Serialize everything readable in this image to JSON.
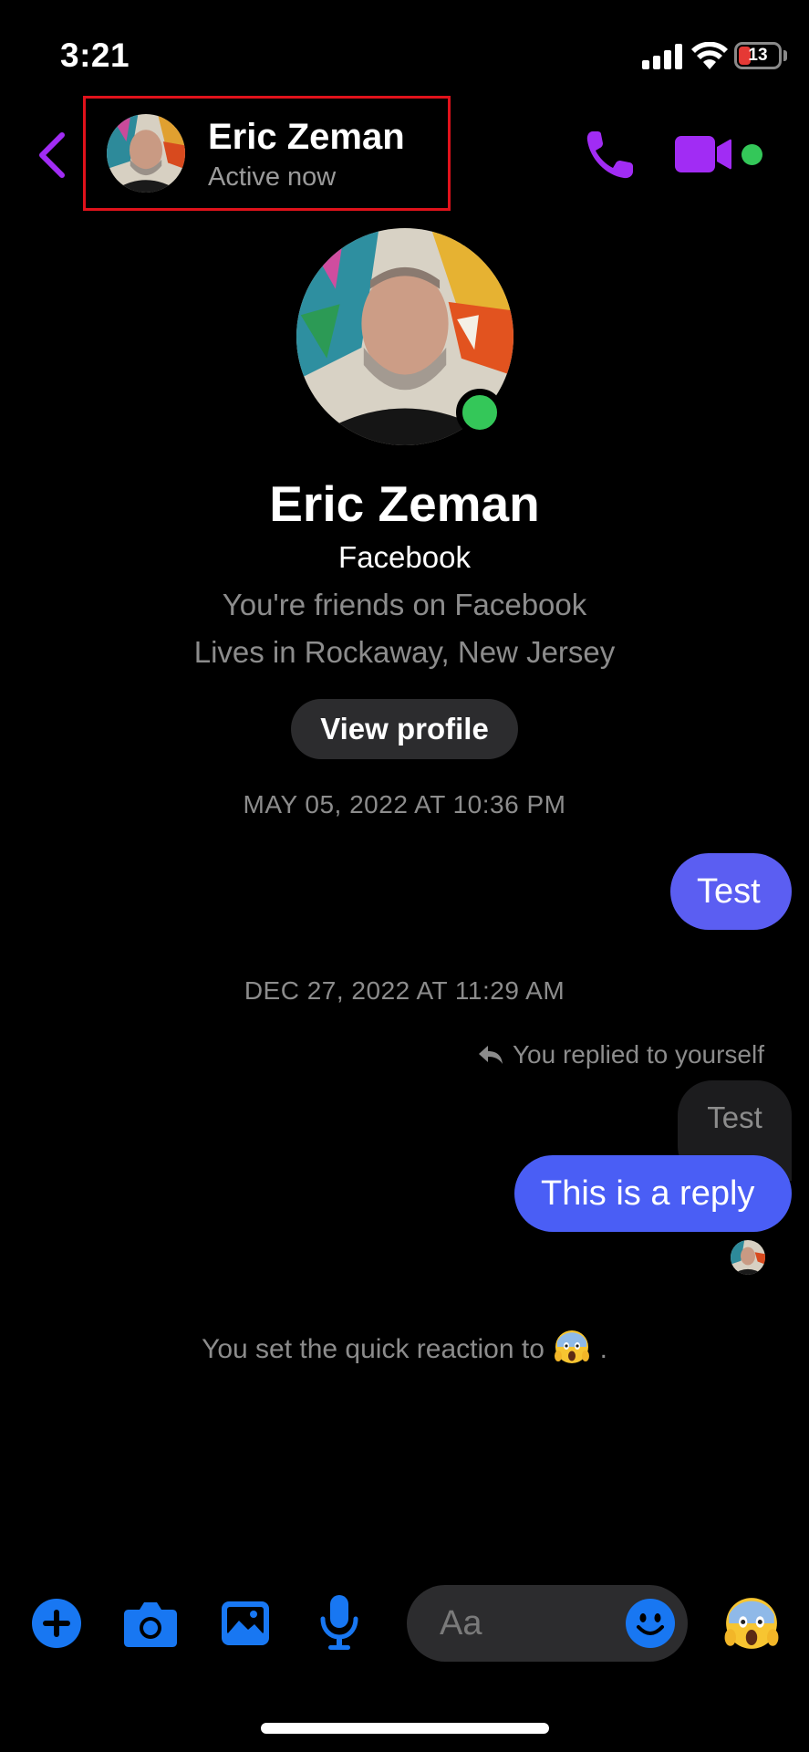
{
  "status_bar": {
    "time": "3:21",
    "battery": "13"
  },
  "header": {
    "name": "Eric Zeman",
    "status": "Active now"
  },
  "profile": {
    "name": "Eric Zeman",
    "source": "Facebook",
    "friends": "You're friends on Facebook",
    "location": "Lives in Rockaway, New Jersey",
    "view_button": "View profile"
  },
  "messages": {
    "timestamp1": "MAY 05, 2022 AT 10:36 PM",
    "msg1": "Test",
    "timestamp2": "DEC 27, 2022 AT 11:29 AM",
    "replied_note": "You replied to yourself",
    "quoted": "Test",
    "reply": "This is a reply",
    "quick_reaction_note": "You set the quick reaction to",
    "quick_reaction_end": "."
  },
  "composer": {
    "placeholder": "Aa"
  },
  "colors": {
    "accent": "#a12cf4",
    "tool_blue": "#1877f2",
    "bubble_primary": "#5b5ef2",
    "online": "#34c759",
    "highlight": "#e0121b"
  },
  "icons": [
    "back-chevron-icon",
    "phone-icon",
    "video-camera-icon",
    "plus-icon",
    "camera-icon",
    "photo-icon",
    "microphone-icon",
    "smiley-icon",
    "screaming-face-emoji",
    "reply-arrow-icon"
  ]
}
